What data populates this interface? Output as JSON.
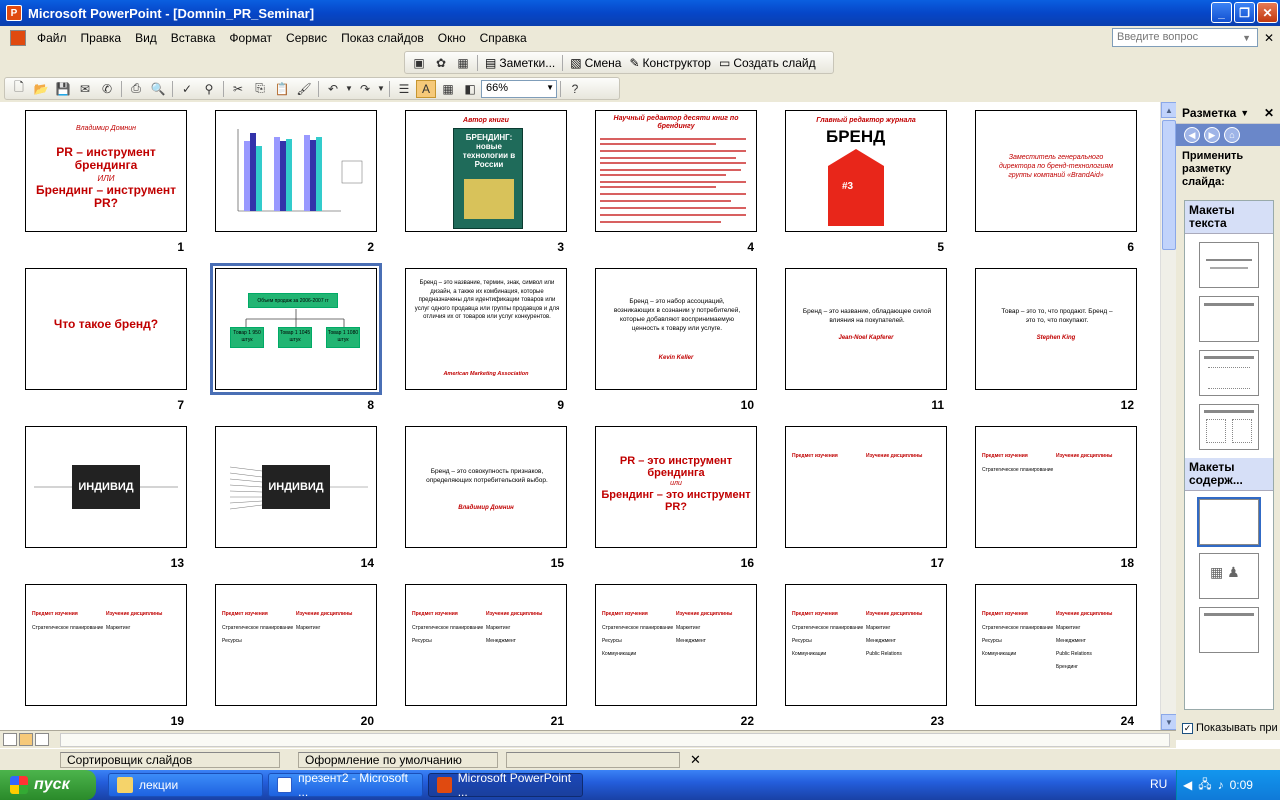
{
  "window": {
    "title": "Microsoft PowerPoint - [Domnin_PR_Seminar]"
  },
  "menu": {
    "items": [
      "Файл",
      "Правка",
      "Вид",
      "Вставка",
      "Формат",
      "Сервис",
      "Показ слайдов",
      "Окно",
      "Справка"
    ],
    "help_placeholder": "Введите вопрос"
  },
  "toolbar2": {
    "notes": "Заметки...",
    "transition": "Смена",
    "designer": "Конструктор",
    "new_slide": "Создать слайд"
  },
  "toolbar3": {
    "zoom": "66%"
  },
  "slides": [
    {
      "num": "1",
      "lines": [
        "Владимир Домнин",
        "PR – инструмент брендинга",
        "ИЛИ",
        "Брендинг – инструмент PR?"
      ]
    },
    {
      "num": "2",
      "kind": "chart"
    },
    {
      "num": "3",
      "title": "Автор книги",
      "book": "БРЕНДИНГ: новые технологии в России"
    },
    {
      "num": "4",
      "title": "Научный редактор десяти книг по брендингу"
    },
    {
      "num": "5",
      "title": "Главный редактор журнала",
      "mag": "БРЕНД"
    },
    {
      "num": "6",
      "text": "Заместитель генерального директора по бренд-технологиям группы компаний «BrandAid»"
    },
    {
      "num": "7",
      "text": "Что такое бренд?"
    },
    {
      "num": "8",
      "diagram": {
        "top": "Объем продаж за 2006-2007 гг",
        "boxes": [
          "Товар 1 950 штук",
          "Товар 1 1045 штук",
          "Товар 1 1080 штук"
        ]
      }
    },
    {
      "num": "9",
      "text": "Бренд – это название, термин, знак, символ или дизайн, а также их комбинация, которые предназначены для идентификации товаров или услуг одного продавца или группы продавцов и для отличия их от товаров или услуг конкурентов.",
      "author": "American Marketing Association"
    },
    {
      "num": "10",
      "text": "Бренд – это набор ассоциаций, возникающих в сознании у потребителей, которые добавляют воспринимаемую ценность к товару или услуге.",
      "author": "Kevin Keller"
    },
    {
      "num": "11",
      "text": "Бренд – это название, обладающее силой влияния на покупателей.",
      "author": "Jean-Noel Kapferer"
    },
    {
      "num": "12",
      "text": "Товар – это то, что продают. Бренд – это то, что покупают.",
      "author": "Stephen King"
    },
    {
      "num": "13",
      "box": "ИНДИВИД"
    },
    {
      "num": "14",
      "box": "ИНДИВИД"
    },
    {
      "num": "15",
      "text": "Бренд – это совокупность признаков, определяющих потребительский выбор.",
      "author": "Владимир Домнин"
    },
    {
      "num": "16",
      "lines": [
        "PR – это инструмент брендинга",
        "или",
        "Брендинг – это инструмент PR?"
      ]
    },
    {
      "num": "17",
      "head": [
        "Предмет изучения",
        "Изучение дисциплины"
      ],
      "rows": []
    },
    {
      "num": "18",
      "head": [
        "Предмет изучения",
        "Изучение дисциплины"
      ],
      "rows": [
        [
          "Стратегическое планирование",
          ""
        ]
      ]
    },
    {
      "num": "19",
      "head": [
        "Предмет изучения",
        "Изучение дисциплины"
      ],
      "rows": [
        [
          "Стратегическое планирование",
          "Маркетинг"
        ]
      ]
    },
    {
      "num": "20",
      "head": [
        "Предмет изучения",
        "Изучение дисциплины"
      ],
      "rows": [
        [
          "Стратегическое планирование",
          "Маркетинг"
        ],
        [
          "Ресурсы",
          ""
        ]
      ]
    },
    {
      "num": "21",
      "head": [
        "Предмет изучения",
        "Изучение дисциплины"
      ],
      "rows": [
        [
          "Стратегическое планирование",
          "Маркетинг"
        ],
        [
          "Ресурсы",
          "Менеджмент"
        ]
      ]
    },
    {
      "num": "22",
      "head": [
        "Предмет изучения",
        "Изучение дисциплины"
      ],
      "rows": [
        [
          "Стратегическое планирование",
          "Маркетинг"
        ],
        [
          "Ресурсы",
          "Менеджмент"
        ],
        [
          "Коммуникации",
          ""
        ]
      ]
    },
    {
      "num": "23",
      "head": [
        "Предмет изучения",
        "Изучение дисциплины"
      ],
      "rows": [
        [
          "Стратегическое планирование",
          "Маркетинг"
        ],
        [
          "Ресурсы",
          "Менеджмент"
        ],
        [
          "Коммуникации",
          "Public Relations"
        ]
      ]
    },
    {
      "num": "24",
      "head": [
        "Предмет изучения",
        "Изучение дисциплины"
      ],
      "rows": [
        [
          "Стратегическое планирование",
          "Маркетинг"
        ],
        [
          "Ресурсы",
          "Менеджмент"
        ],
        [
          "Коммуникации",
          "Public Relations"
        ],
        [
          "",
          "Брендинг"
        ]
      ]
    }
  ],
  "taskpane": {
    "title": "Разметка",
    "apply": "Применить разметку слайда:",
    "sec_text": "Макеты текста",
    "sec_content": "Макеты содерж...",
    "show_label": "Показывать при"
  },
  "status": {
    "view": "Сортировщик слайдов",
    "design": "Оформление по умолчанию"
  },
  "taskbar": {
    "start": "пуск",
    "tasks": [
      "лекции",
      "презент2 - Microsoft ...",
      "Microsoft PowerPoint ..."
    ],
    "lang": "RU",
    "clock": "0:09"
  }
}
